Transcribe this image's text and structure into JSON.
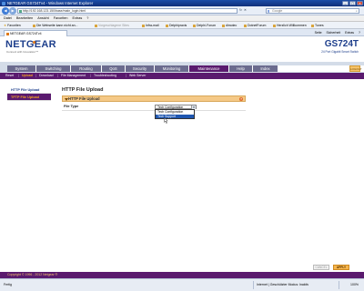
{
  "window": {
    "title": "NETGEAR GS724Tv4 - Windows Internet Explorer",
    "controls": [
      "–",
      "▢",
      "✕"
    ]
  },
  "address": {
    "url": "http://192.168.123.150/base/main_login.html",
    "search_placeholder": "Google"
  },
  "menu": [
    "Datei",
    "Bearbeiten",
    "Ansicht",
    "Favoriten",
    "Extras",
    "?"
  ],
  "favorites": [
    {
      "label": "Favoriten"
    },
    {
      "label": "Die Webseite kann nicht an..."
    },
    {
      "label": "Vorgeschlagene Sites"
    },
    {
      "label": "Infra-mail"
    },
    {
      "label": "Delphipraxis"
    },
    {
      "label": "Delphi-Forum"
    },
    {
      "label": "dimotec"
    },
    {
      "label": "DotnetForum"
    },
    {
      "label": "Herzlich Willkommen"
    },
    {
      "label": "Tunes"
    }
  ],
  "tab": {
    "label": "NETGEAR GS724Tv4",
    "tools": [
      "Seite",
      "Sicherheit",
      "Extras",
      "?"
    ]
  },
  "brand": {
    "logo": "NETGEAR",
    "tagline": "Connect with Innovation™",
    "model": "GS724T",
    "model_sub": "24 Port Gigabit Smart Switch"
  },
  "main_tabs": [
    "System",
    "Switching",
    "Routing",
    "QoS",
    "Security",
    "Monitoring",
    "Maintenance",
    "Help",
    "Index"
  ],
  "logout": "LOGOUT",
  "sub_tabs": [
    "Reset",
    "Upload",
    "Download",
    "File Management",
    "Troubleshooting",
    "Web Server"
  ],
  "sidebar": [
    "HTTP File Upload",
    "TFTP File Upload"
  ],
  "page": {
    "title": "HTTP File Upload",
    "panel_title": "HTTP File Upload",
    "help": "?",
    "file_type_label": "File Type",
    "file_type_value": "Tech Configuration",
    "options": [
      "Tech Configuration",
      "Tech Support"
    ]
  },
  "buttons": {
    "cancel": "CANCEL",
    "apply": "APPLY"
  },
  "copyright": "Copyright © 1996 - 2012 Netgear ®",
  "status": {
    "text": "Fertig",
    "zone": "Internet | Geschützter Modus: Inaktiv",
    "zoom": "100%"
  },
  "colors": {
    "accent_purple": "#5a1a6e",
    "active_orange": "#f5a623",
    "panel_orange": "#f5c987",
    "brand_blue": "#1e3f8c"
  }
}
